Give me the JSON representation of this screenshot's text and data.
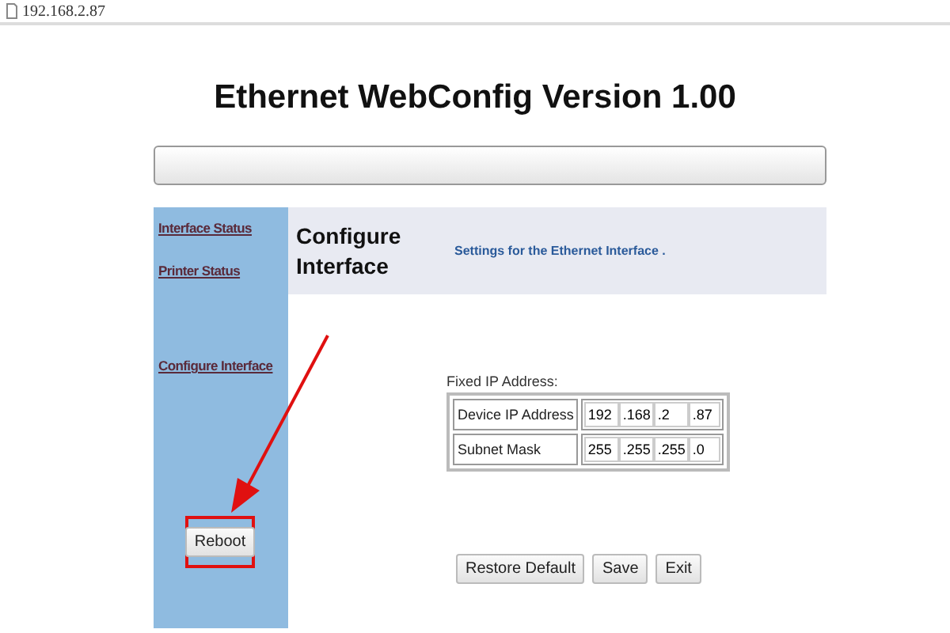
{
  "address_bar": {
    "url": "192.168.2.87"
  },
  "title": "Ethernet WebConfig Version 1.00",
  "sidebar": {
    "links": [
      "Interface Status",
      "Printer Status",
      "Configure Interface"
    ],
    "reboot_button": "Reboot"
  },
  "header": {
    "heading": "Configure Interface",
    "subtitle": "Settings for the Ethernet Interface ."
  },
  "form": {
    "legend": "Fixed IP Address:",
    "rows": [
      {
        "label": "Device IP Address",
        "octets": [
          "192",
          ".168",
          ".2",
          ".87"
        ]
      },
      {
        "label": "Subnet Mask",
        "octets": [
          "255",
          ".255",
          ".255",
          ".0"
        ]
      }
    ]
  },
  "buttons": [
    "Restore Default",
    "Save",
    "Exit"
  ]
}
